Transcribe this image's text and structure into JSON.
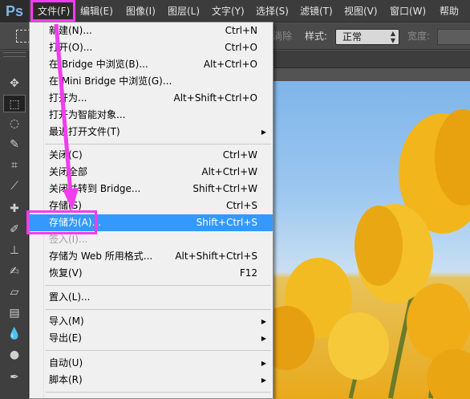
{
  "app": {
    "logo": "Ps"
  },
  "menubar": {
    "items": [
      "文件(F)",
      "编辑(E)",
      "图像(I)",
      "图层(L)",
      "文字(Y)",
      "选择(S)",
      "滤镜(T)",
      "视图(V)",
      "窗口(W)",
      "帮助"
    ]
  },
  "options": {
    "partial_label": "淌除",
    "style_label": "样式:",
    "style_value": "正常",
    "width_label": "宽度:"
  },
  "file_menu": {
    "items": [
      {
        "label": "新建(N)...",
        "shortcut": "Ctrl+N"
      },
      {
        "label": "打开(O)...",
        "shortcut": "Ctrl+O"
      },
      {
        "label": "在 Bridge 中浏览(B)...",
        "shortcut": "Alt+Ctrl+O"
      },
      {
        "label": "在 Mini Bridge 中浏览(G)...",
        "shortcut": ""
      },
      {
        "label": "打开为...",
        "shortcut": "Alt+Shift+Ctrl+O"
      },
      {
        "label": "打开为智能对象...",
        "shortcut": ""
      },
      {
        "label": "最近打开文件(T)",
        "shortcut": ""
      },
      {
        "label": "关闭(C)",
        "shortcut": "Ctrl+W"
      },
      {
        "label": "关闭全部",
        "shortcut": "Alt+Ctrl+W"
      },
      {
        "label": "关闭并转到 Bridge...",
        "shortcut": "Shift+Ctrl+W"
      },
      {
        "label": "存储(S)",
        "shortcut": "Ctrl+S"
      },
      {
        "label": "存储为(A)...",
        "shortcut": "Shift+Ctrl+S"
      },
      {
        "label": "签入(I)...",
        "shortcut": ""
      },
      {
        "label": "存储为 Web 所用格式...",
        "shortcut": "Alt+Shift+Ctrl+S"
      },
      {
        "label": "恢复(V)",
        "shortcut": "F12"
      },
      {
        "label": "置入(L)...",
        "shortcut": ""
      },
      {
        "label": "导入(M)",
        "shortcut": ""
      },
      {
        "label": "导出(E)",
        "shortcut": ""
      },
      {
        "label": "自动(U)",
        "shortcut": ""
      },
      {
        "label": "脚本(R)",
        "shortcut": ""
      }
    ]
  },
  "colors": {
    "highlight": "#3399ff",
    "annotation": "#f23cf0"
  }
}
